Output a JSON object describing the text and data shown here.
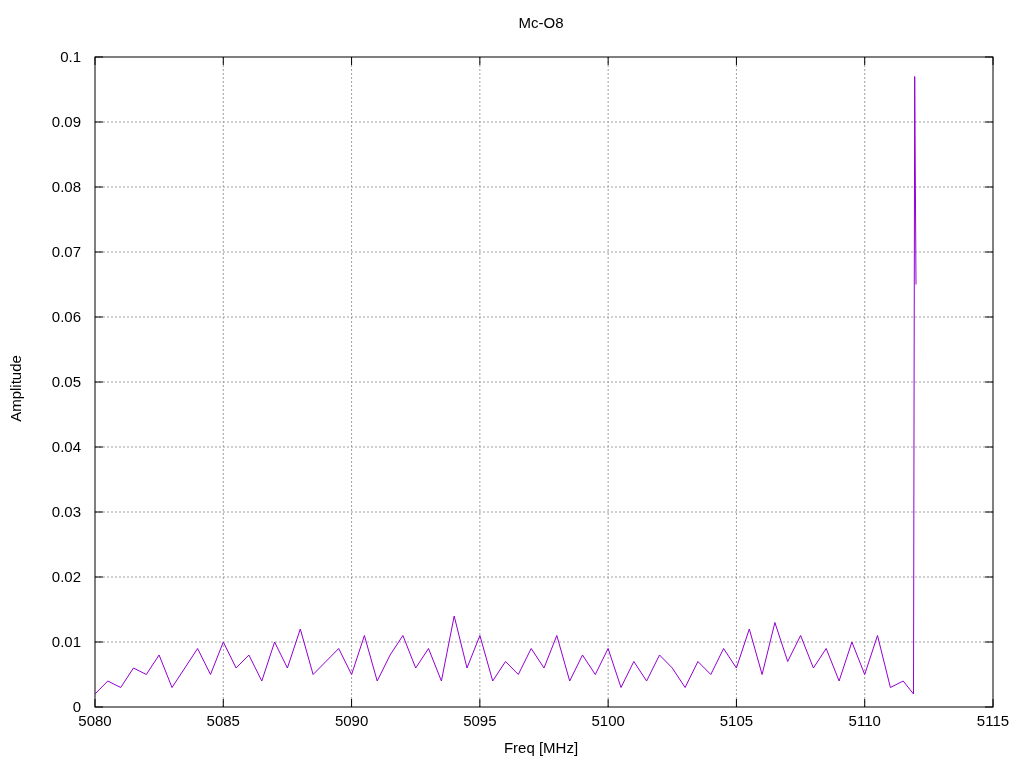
{
  "chart_data": {
    "type": "line",
    "title": "Mc-O8",
    "xlabel": "Freq [MHz]",
    "ylabel": "Amplitude",
    "x": [
      5080,
      5080.5,
      5081,
      5081.5,
      5082,
      5082.5,
      5083,
      5083.5,
      5084,
      5084.5,
      5085,
      5085.5,
      5086,
      5086.5,
      5087,
      5087.5,
      5088,
      5088.5,
      5089,
      5089.5,
      5090,
      5090.5,
      5091,
      5091.5,
      5092,
      5092.5,
      5093,
      5093.5,
      5094,
      5094.5,
      5095,
      5095.5,
      5096,
      5096.5,
      5097,
      5097.5,
      5098,
      5098.5,
      5099,
      5099.5,
      5100,
      5100.5,
      5101,
      5101.5,
      5102,
      5102.5,
      5103,
      5103.5,
      5104,
      5104.5,
      5105,
      5105.5,
      5106,
      5106.5,
      5107,
      5107.5,
      5108,
      5108.5,
      5109,
      5109.5,
      5110,
      5110.5,
      5111,
      5111.5,
      5111.9,
      5111.95,
      5112
    ],
    "grid": true,
    "series": [
      {
        "color": "#9400d3",
        "values": [
          0.002,
          0.004,
          0.003,
          0.006,
          0.005,
          0.008,
          0.003,
          0.006,
          0.009,
          0.005,
          0.01,
          0.006,
          0.008,
          0.004,
          0.01,
          0.006,
          0.012,
          0.005,
          0.007,
          0.009,
          0.005,
          0.011,
          0.004,
          0.008,
          0.011,
          0.006,
          0.009,
          0.004,
          0.014,
          0.006,
          0.011,
          0.004,
          0.007,
          0.005,
          0.009,
          0.006,
          0.011,
          0.004,
          0.008,
          0.005,
          0.009,
          0.003,
          0.007,
          0.004,
          0.008,
          0.006,
          0.003,
          0.007,
          0.005,
          0.009,
          0.006,
          0.012,
          0.005,
          0.013,
          0.007,
          0.011,
          0.006,
          0.009,
          0.004,
          0.01,
          0.005,
          0.011,
          0.003,
          0.004,
          0.002,
          0.097,
          0.065
        ]
      }
    ],
    "xlim": [
      5080,
      5115
    ],
    "ylim": [
      0,
      0.1
    ],
    "xticks": [
      5080,
      5085,
      5090,
      5095,
      5100,
      5105,
      5110,
      5115
    ],
    "yticks": [
      0,
      0.01,
      0.02,
      0.03,
      0.04,
      0.05,
      0.06,
      0.07,
      0.08,
      0.09,
      0.1
    ]
  }
}
